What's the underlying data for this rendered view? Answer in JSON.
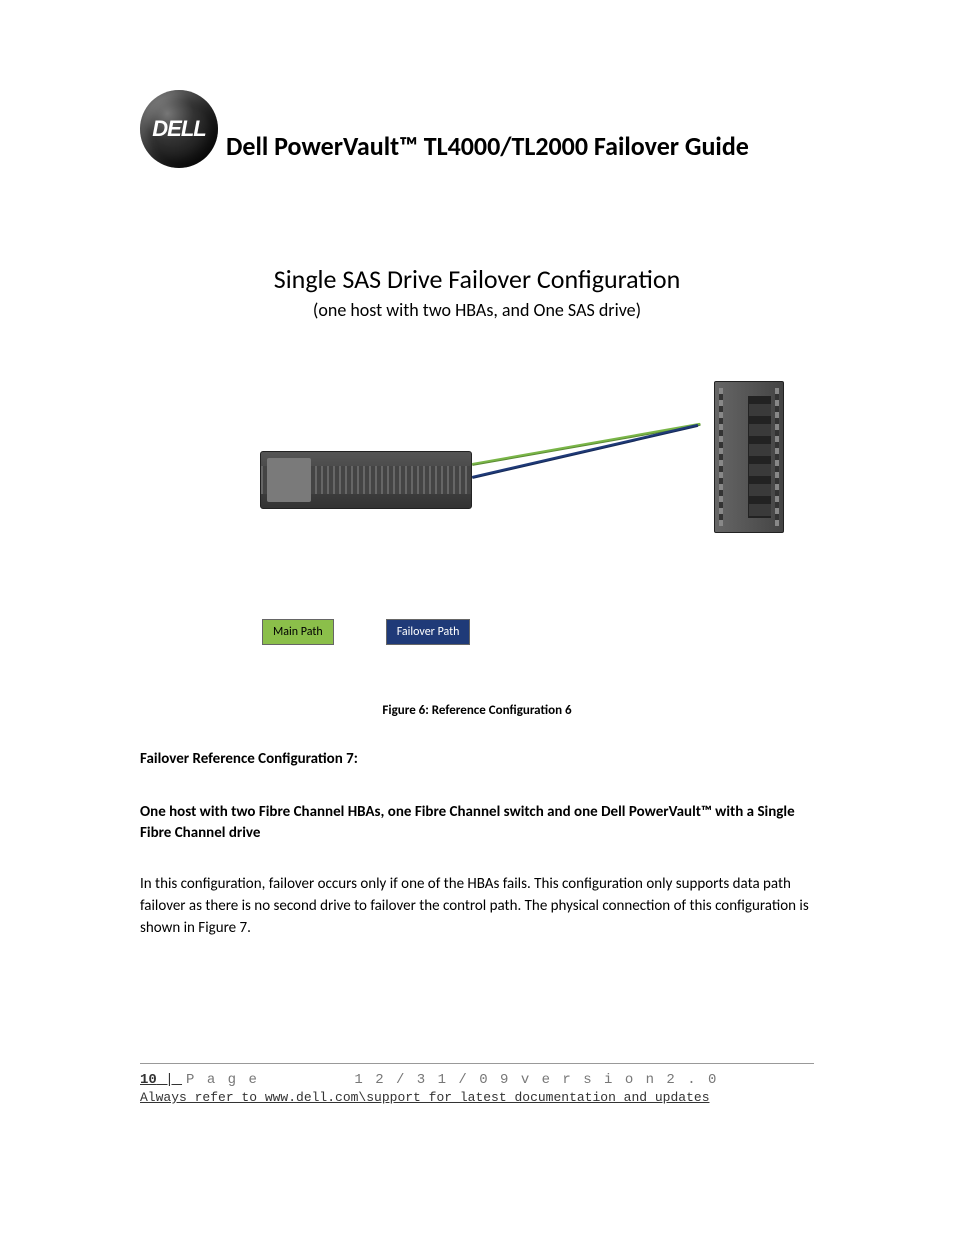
{
  "header": {
    "logo_text": "DELL",
    "doc_title": "Dell PowerVault™ TL4000/TL2000 Failover Guide"
  },
  "section": {
    "title": "Single SAS Drive Failover Configuration",
    "subtitle": "(one host with two HBAs, and One SAS drive)"
  },
  "legend": {
    "main": "Main Path",
    "failover": "Failover Path"
  },
  "figure_caption": "Figure 6: Reference Configuration 6",
  "config7": {
    "heading": "Failover Reference Configuration 7:",
    "sub": "One host with two Fibre Channel HBAs, one Fibre Channel switch and one Dell PowerVault™ with a Single Fibre Channel drive",
    "body": "In this configuration, failover occurs only if one of the HBAs fails.  This configuration only supports data path failover as there is no second drive to failover the control path.  The physical connection of this configuration is shown in Figure 7."
  },
  "footer": {
    "page_num": "10",
    "page_label": "P a g e",
    "version": "1 2 / 3 1 / 0 9   v e r s i o n   2 . 0",
    "note": "Always refer to www.dell.com\\support for latest documentation and updates"
  }
}
